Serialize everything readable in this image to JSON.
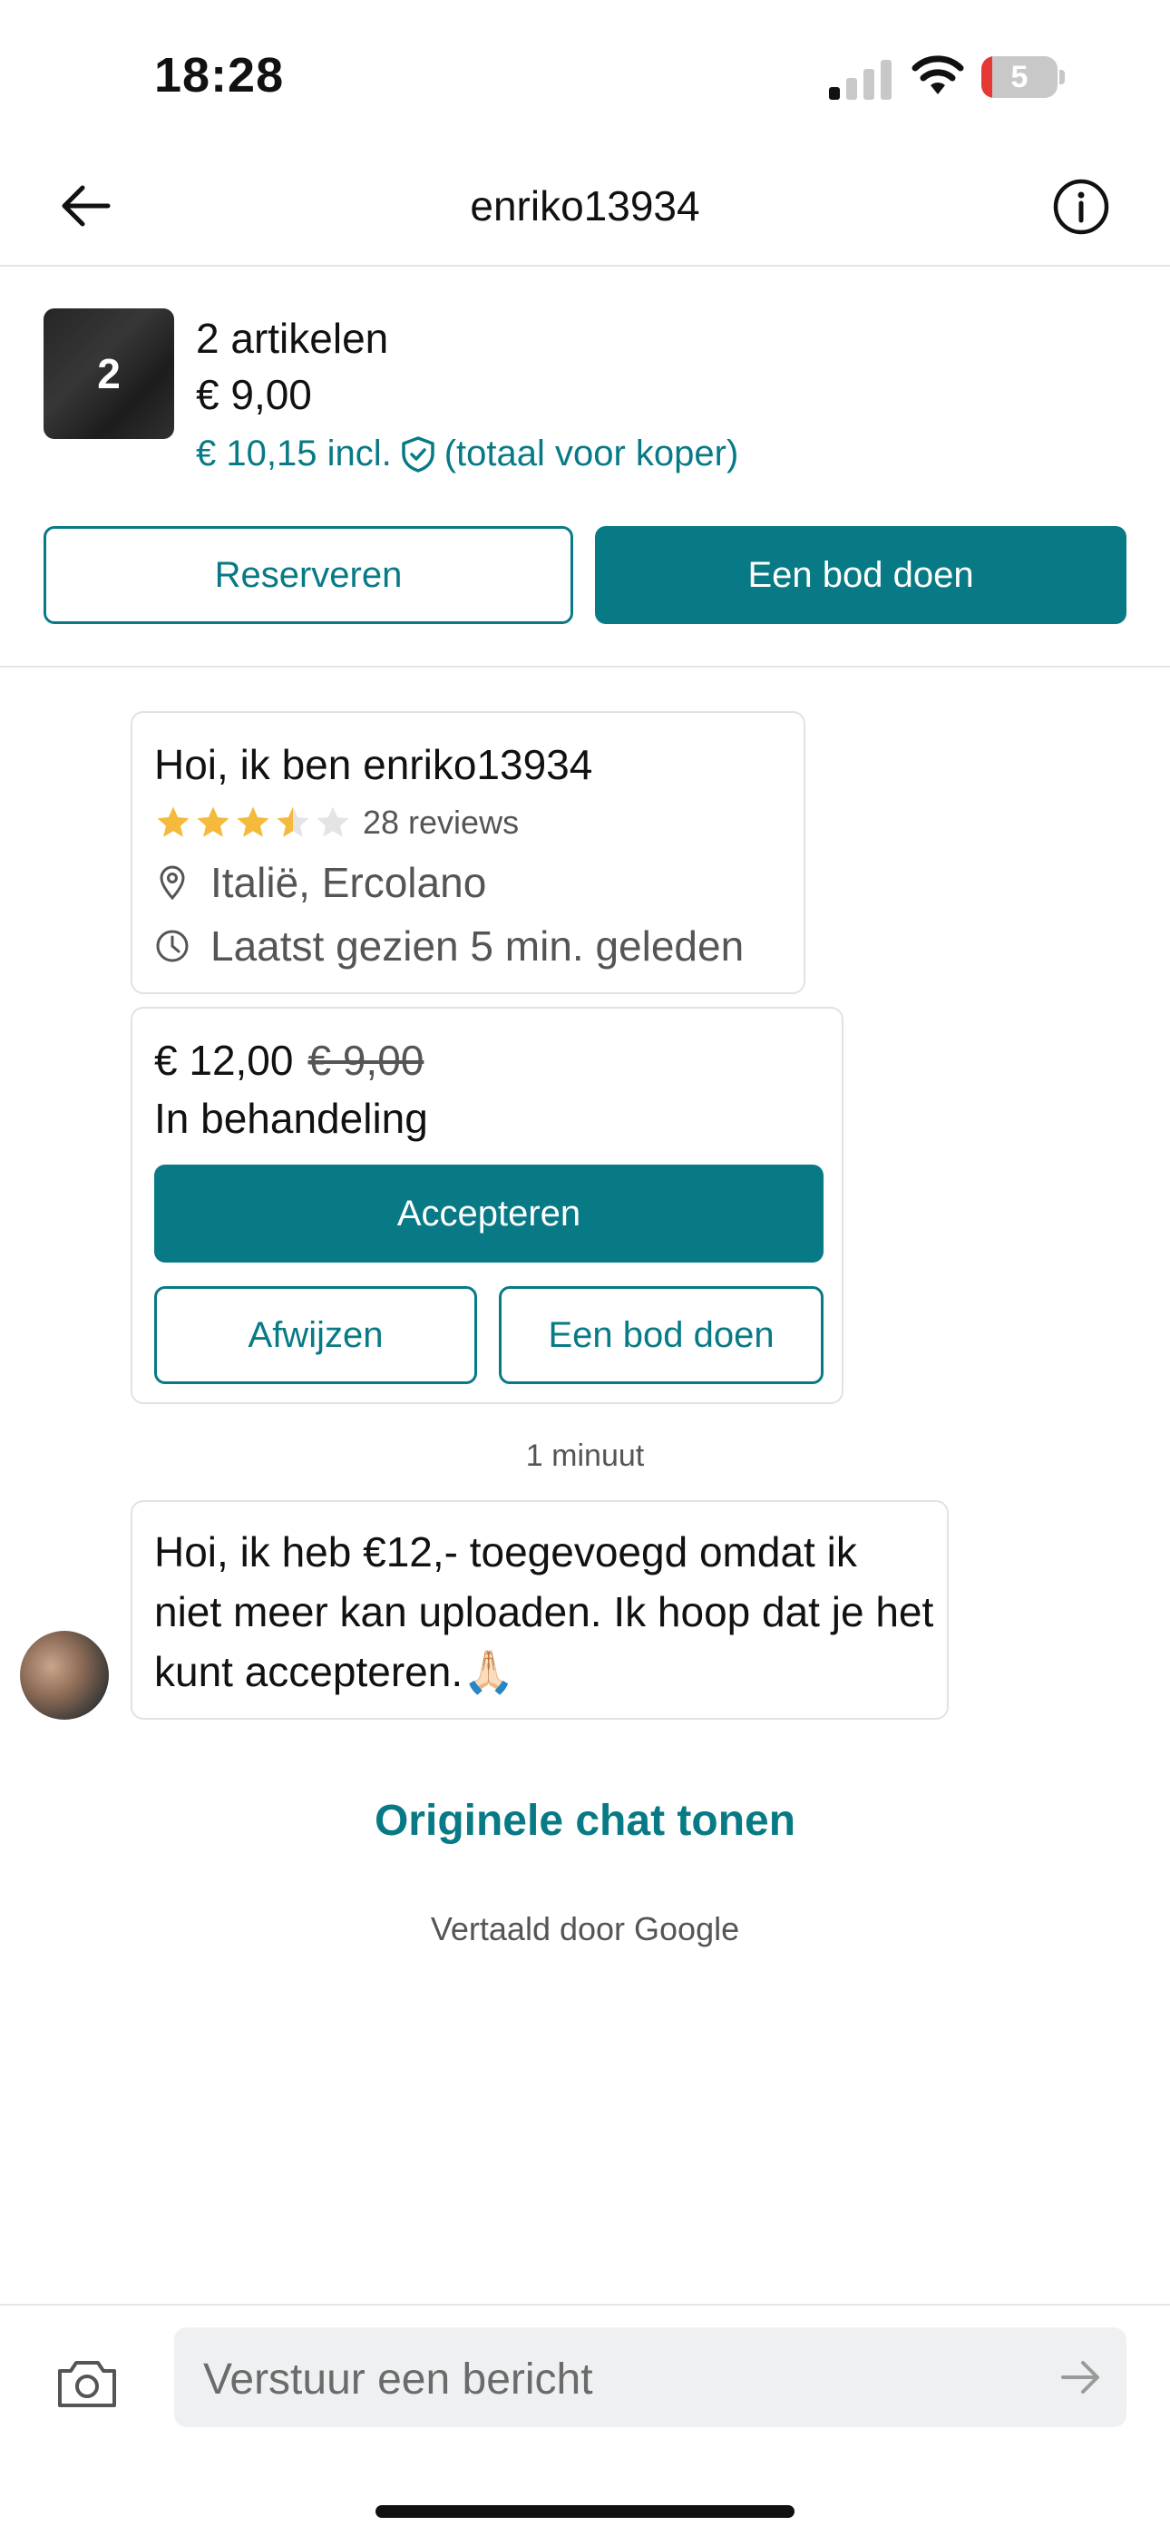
{
  "status_bar": {
    "time": "18:28",
    "battery_level": "5",
    "icons": [
      "signal-icon",
      "wifi-icon",
      "battery-icon"
    ]
  },
  "header": {
    "title": "enriko13934",
    "back_icon": "arrow-left-icon",
    "info_icon": "info-icon"
  },
  "summary": {
    "thumb_count": "2",
    "title": "2 artikelen",
    "price": "€ 9,00",
    "incl_price": "€ 10,15 incl.",
    "incl_suffix": "(totaal voor koper)",
    "reserve_label": "Reserveren",
    "offer_label": "Een bod doen"
  },
  "profile": {
    "greeting": "Hoi, ik ben enriko13934",
    "rating": 3.5,
    "max_rating": 5,
    "reviews": "28 reviews",
    "location": "Italië, Ercolano",
    "last_seen": "Laatst gezien 5 min. geleden"
  },
  "offer": {
    "new_price": "€ 12,00",
    "old_price": "€ 9,00",
    "status": "In behandeling",
    "accept_label": "Accepteren",
    "reject_label": "Afwijzen",
    "counter_label": "Een bod doen"
  },
  "chat": {
    "timestamp": "1 minuut",
    "message": "Hoi, ik heb €12,- toegevoegd omdat ik niet meer kan uploaden. Ik hoop dat je het kunt accepteren.🙏🏻",
    "show_original": "Originele chat tonen",
    "translated_by": "Vertaald door Google"
  },
  "input": {
    "placeholder": "Verstuur een bericht"
  },
  "colors": {
    "accent": "#087a85",
    "star": "#f5b93b",
    "battery_low": "#e53935"
  }
}
